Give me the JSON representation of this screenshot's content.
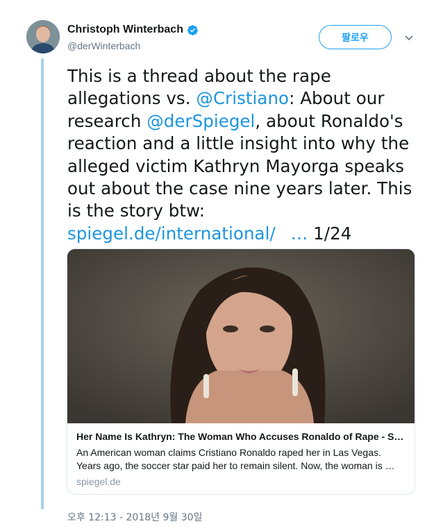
{
  "author": {
    "display_name": "Christoph Winterbach",
    "handle": "@derWinterbach",
    "verified": true
  },
  "follow_button": {
    "label": "팔로우"
  },
  "tweet": {
    "line1": "This is a thread about the rape",
    "line2_a": "allegations vs. ",
    "line2_mention": "@Cristiano",
    "line2_b": ": About our",
    "line3_a": "research ",
    "line3_mention": "@derSpiegel",
    "line3_b": ", about Ronaldo's",
    "line4": "reaction and a little insight into why the",
    "line5": "alleged victim Kathryn Mayorga speaks",
    "line6": "out about the case nine years later. This",
    "line7": "is the story btw:",
    "link": "spiegel.de/international/",
    "ellipsis": "…",
    "counter": " 1/24"
  },
  "card": {
    "title": "Her Name Is Kathryn: The Woman Who Accuses Ronaldo of Rape - S…",
    "description_line1": "An American woman claims Cristiano Ronaldo raped her in Las Vegas.",
    "description_line2": "Years ago, the soccer star paid her to remain silent. Now, the woman is …",
    "domain": "spiegel.de"
  },
  "timestamp": "오후 12:13 - 2018년 9월 30일",
  "colors": {
    "link": "#1b95e0",
    "thread_line": "#a6d1e7",
    "verified": "#1da1f2"
  }
}
